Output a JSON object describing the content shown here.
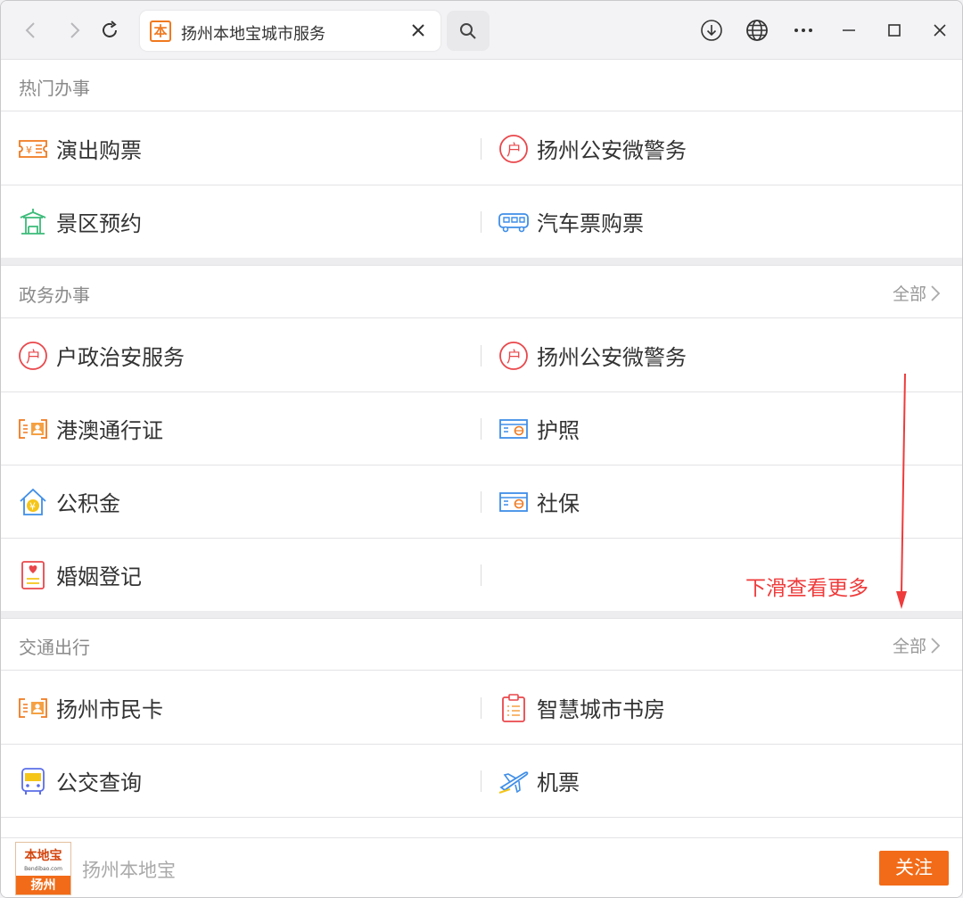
{
  "browser": {
    "tab_title": "扬州本地宝城市服务",
    "favicon_text": "本"
  },
  "sections": [
    {
      "title": "热门办事",
      "more": "",
      "rows": [
        [
          {
            "label": "演出购票",
            "icon": "ticket-icon"
          },
          {
            "label": "扬州公安微警务",
            "icon": "police-hu-icon"
          }
        ],
        [
          {
            "label": "景区预约",
            "icon": "pavilion-icon"
          },
          {
            "label": "汽车票购票",
            "icon": "bus-side-icon"
          }
        ]
      ]
    },
    {
      "title": "政务办事",
      "more": "全部",
      "rows": [
        [
          {
            "label": "户政治安服务",
            "icon": "police-hu-icon"
          },
          {
            "label": "扬州公安微警务",
            "icon": "police-hu-icon"
          }
        ],
        [
          {
            "label": "港澳通行证",
            "icon": "id-card-icon"
          },
          {
            "label": "护照",
            "icon": "passport-icon"
          }
        ],
        [
          {
            "label": "公积金",
            "icon": "house-fund-icon"
          },
          {
            "label": "社保",
            "icon": "social-card-icon"
          }
        ],
        [
          {
            "label": "婚姻登记",
            "icon": "marriage-cert-icon"
          },
          null
        ]
      ]
    },
    {
      "title": "交通出行",
      "more": "全部",
      "rows": [
        [
          {
            "label": "扬州市民卡",
            "icon": "id-card-icon"
          },
          {
            "label": "智慧城市书房",
            "icon": "clipboard-icon"
          }
        ],
        [
          {
            "label": "公交查询",
            "icon": "bus-front-icon"
          },
          {
            "label": "机票",
            "icon": "airplane-icon"
          }
        ]
      ]
    }
  ],
  "annotation": {
    "text": "下滑查看更多",
    "color": "#ef3b3b"
  },
  "footer": {
    "logo_top": "本地宝",
    "logo_url": "Bendibao.com",
    "logo_city": "扬州",
    "name": "扬州本地宝",
    "follow_label": "关注"
  },
  "colors": {
    "accent": "#f26b18"
  }
}
